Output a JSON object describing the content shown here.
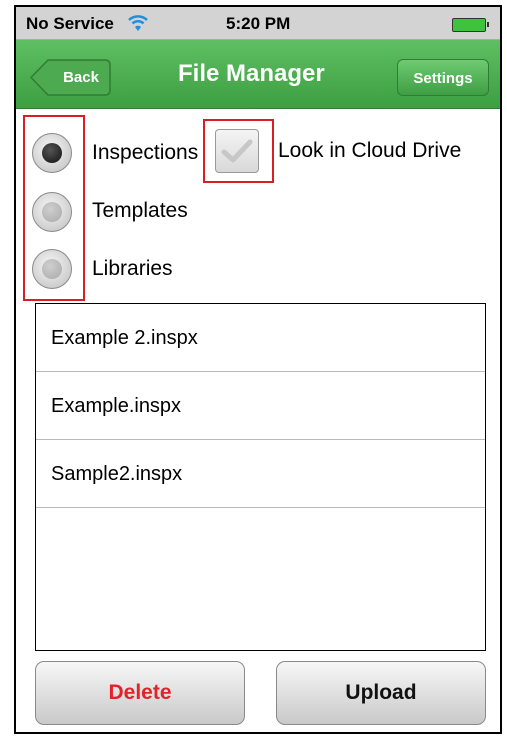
{
  "status_bar": {
    "carrier": "No Service",
    "time": "5:20 PM",
    "wifi_icon": "wifi-icon",
    "battery_icon": "battery-icon",
    "battery_color": "#3ec43a"
  },
  "nav_bar": {
    "back_label": "Back",
    "title": "File Manager",
    "settings_label": "Settings",
    "color": "#3fa344"
  },
  "file_type": {
    "options": [
      {
        "label": "Inspections",
        "selected": true
      },
      {
        "label": "Templates",
        "selected": false
      },
      {
        "label": "Libraries",
        "selected": false
      }
    ]
  },
  "cloud": {
    "label": "Look in Cloud Drive",
    "checked": false
  },
  "files": [
    "Example 2.inspx",
    "Example.inspx",
    "Sample2.inspx"
  ],
  "actions": {
    "delete_label": "Delete",
    "upload_label": "Upload",
    "delete_color": "#e4222a"
  },
  "highlight_color": "#d81f26"
}
